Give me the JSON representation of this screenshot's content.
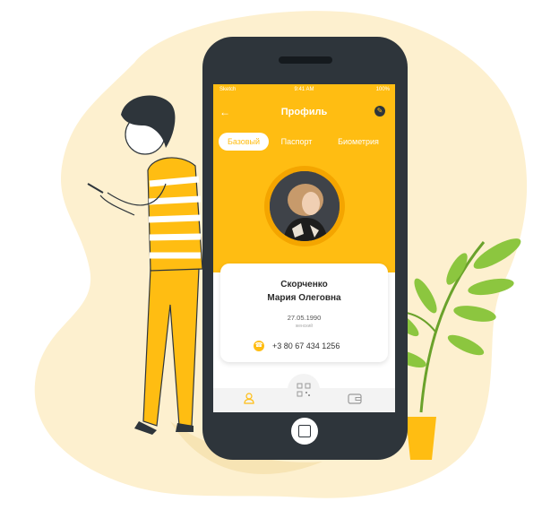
{
  "status_bar": {
    "carrier": "Sketch",
    "time": "9:41 AM",
    "battery": "100%"
  },
  "header": {
    "title": "Профиль",
    "back_icon": "arrow-left-icon",
    "edit_icon": "pencil-icon"
  },
  "tabs": [
    {
      "label": "Базовый",
      "active": true
    },
    {
      "label": "Паспорт",
      "active": false
    },
    {
      "label": "Биометрия",
      "active": false
    }
  ],
  "profile": {
    "surname": "Скорченко",
    "given_names": "Мария Олеговна",
    "birth_date": "27.05.1990",
    "gender": "женский",
    "phone": "+3 80 67 434 1256"
  },
  "bottom_nav": {
    "items": [
      "user-icon",
      "qr-code-icon",
      "wallet-icon"
    ]
  },
  "colors": {
    "accent": "#ffbd12",
    "phone_body": "#2e353b",
    "blob": "#fdf0cf",
    "plant": "#8cc63f"
  }
}
